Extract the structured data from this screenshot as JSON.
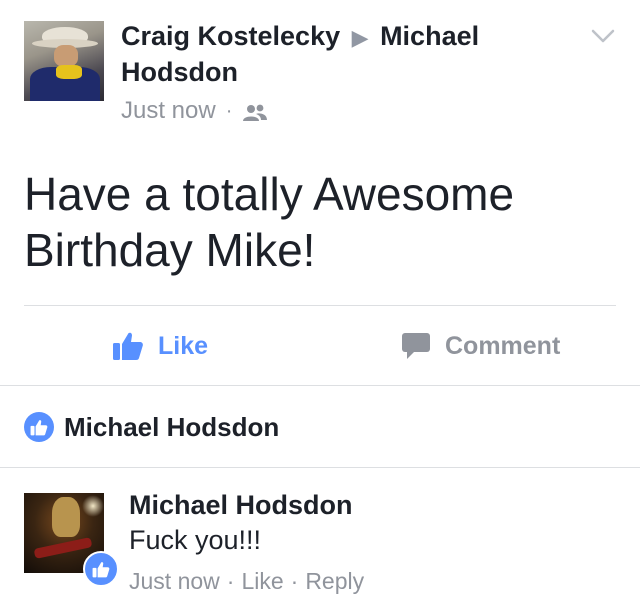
{
  "post": {
    "author": "Craig Kostelecky",
    "arrow": "▶",
    "target": "Michael Hodsdon",
    "timestamp": "Just now",
    "meta_separator": "·",
    "audience_icon": "friends-icon",
    "text": "Have a totally Awesome Birthday Mike!",
    "menu_icon": "chevron-down-icon"
  },
  "actions": {
    "like_label": "Like",
    "comment_label": "Comment"
  },
  "likers": {
    "name": "Michael Hodsdon"
  },
  "comment": {
    "author": "Michael Hodsdon",
    "text": "Fuck you!!!",
    "timestamp": "Just now",
    "separator": "·",
    "like_label": "Like",
    "reply_label": "Reply"
  },
  "colors": {
    "accent": "#5890ff",
    "text": "#1d2129",
    "muted": "#90949c",
    "divider": "#dddfe2"
  }
}
